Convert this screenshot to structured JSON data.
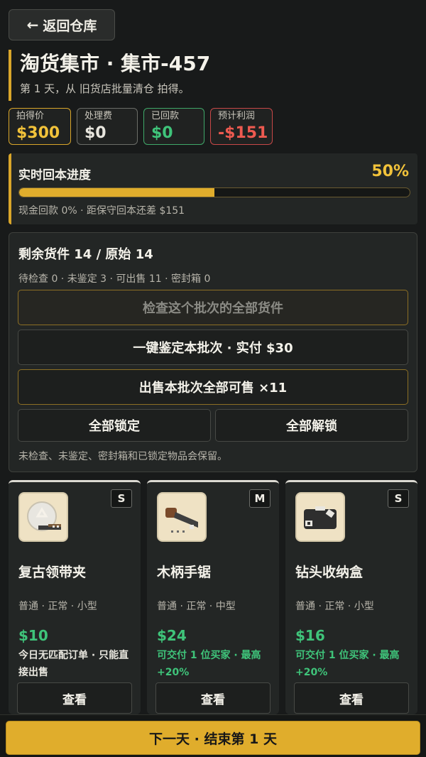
{
  "nav": {
    "back_arrow": "🡐",
    "back_label": "返回仓库"
  },
  "header": {
    "title": "淘货集市 · 集市-457",
    "subtitle": "第 1 天，从 旧货店批量清仓 拍得。"
  },
  "stats": [
    {
      "label": "拍得价",
      "value": "$300",
      "color": "#f1c23a"
    },
    {
      "label": "处理费",
      "value": "$0",
      "color": "#e8e6de"
    },
    {
      "label": "已回款",
      "value": "$0",
      "color": "#3fc47a"
    },
    {
      "label": "预计利润",
      "value": "-$151",
      "color": "#ee5a50"
    }
  ],
  "progress": {
    "title": "实时回本进度",
    "percent_label": "50%",
    "fraction": 0.5,
    "note": "现金回款 0% · 距保守回本还差 $151"
  },
  "lot": {
    "title": "剩余货件 14 / 原始 14",
    "counts": "待检查 0 · 未鉴定 3 · 可出售 11 · 密封箱 0",
    "inspect_all": "检查这个批次的全部货件",
    "appraise_all": "一键鉴定本批次 · 实付 $30",
    "sell_all": "出售本批次全部可售 ×11",
    "lock_all": "全部锁定",
    "unlock_all": "全部解锁",
    "note": "未检查、未鉴定、密封箱和已锁定物品会保留。"
  },
  "items": [
    {
      "name": "复古领带夹",
      "size": "S",
      "tags": "普通 · 正常 · 小型",
      "price": "$10",
      "match": "今日无匹配订单 · 只能直接出售",
      "action": "查看",
      "icon": "tie-clip-icon"
    },
    {
      "name": "木柄手锯",
      "size": "M",
      "tags": "普通 · 正常 · 中型",
      "price": "$24",
      "match": "可交付 1 位买家 · 最高 +20%",
      "action": "查看",
      "icon": "hand-saw-icon"
    },
    {
      "name": "钻头收纳盒",
      "size": "S",
      "tags": "普通 · 正常 · 小型",
      "price": "$16",
      "match": "可交付 1 位买家 · 最高 +20%",
      "action": "查看",
      "icon": "drill-bit-case-icon"
    }
  ],
  "footer": {
    "next_label": "下一天 · 结束第 1 天"
  }
}
